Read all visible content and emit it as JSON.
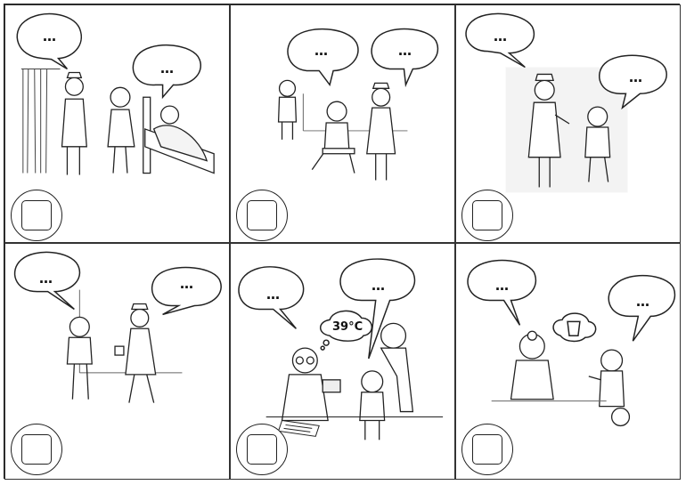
{
  "panels": [
    {
      "bubbles": [
        "…",
        "…"
      ]
    },
    {
      "bubbles": [
        "…",
        "…"
      ]
    },
    {
      "bubbles": [
        "…",
        "…"
      ]
    },
    {
      "bubbles": [
        "…",
        "…"
      ]
    },
    {
      "bubbles": [
        "…",
        "…"
      ],
      "thought_text": "39°C"
    },
    {
      "bubbles": [
        "…",
        "…"
      ]
    }
  ],
  "colors": {
    "line": "#222222",
    "background": "#ffffff",
    "shade": "#f1f1f1"
  },
  "icons": [
    "speech-bubble-icon",
    "thought-bubble-icon",
    "answer-box-icon"
  ]
}
